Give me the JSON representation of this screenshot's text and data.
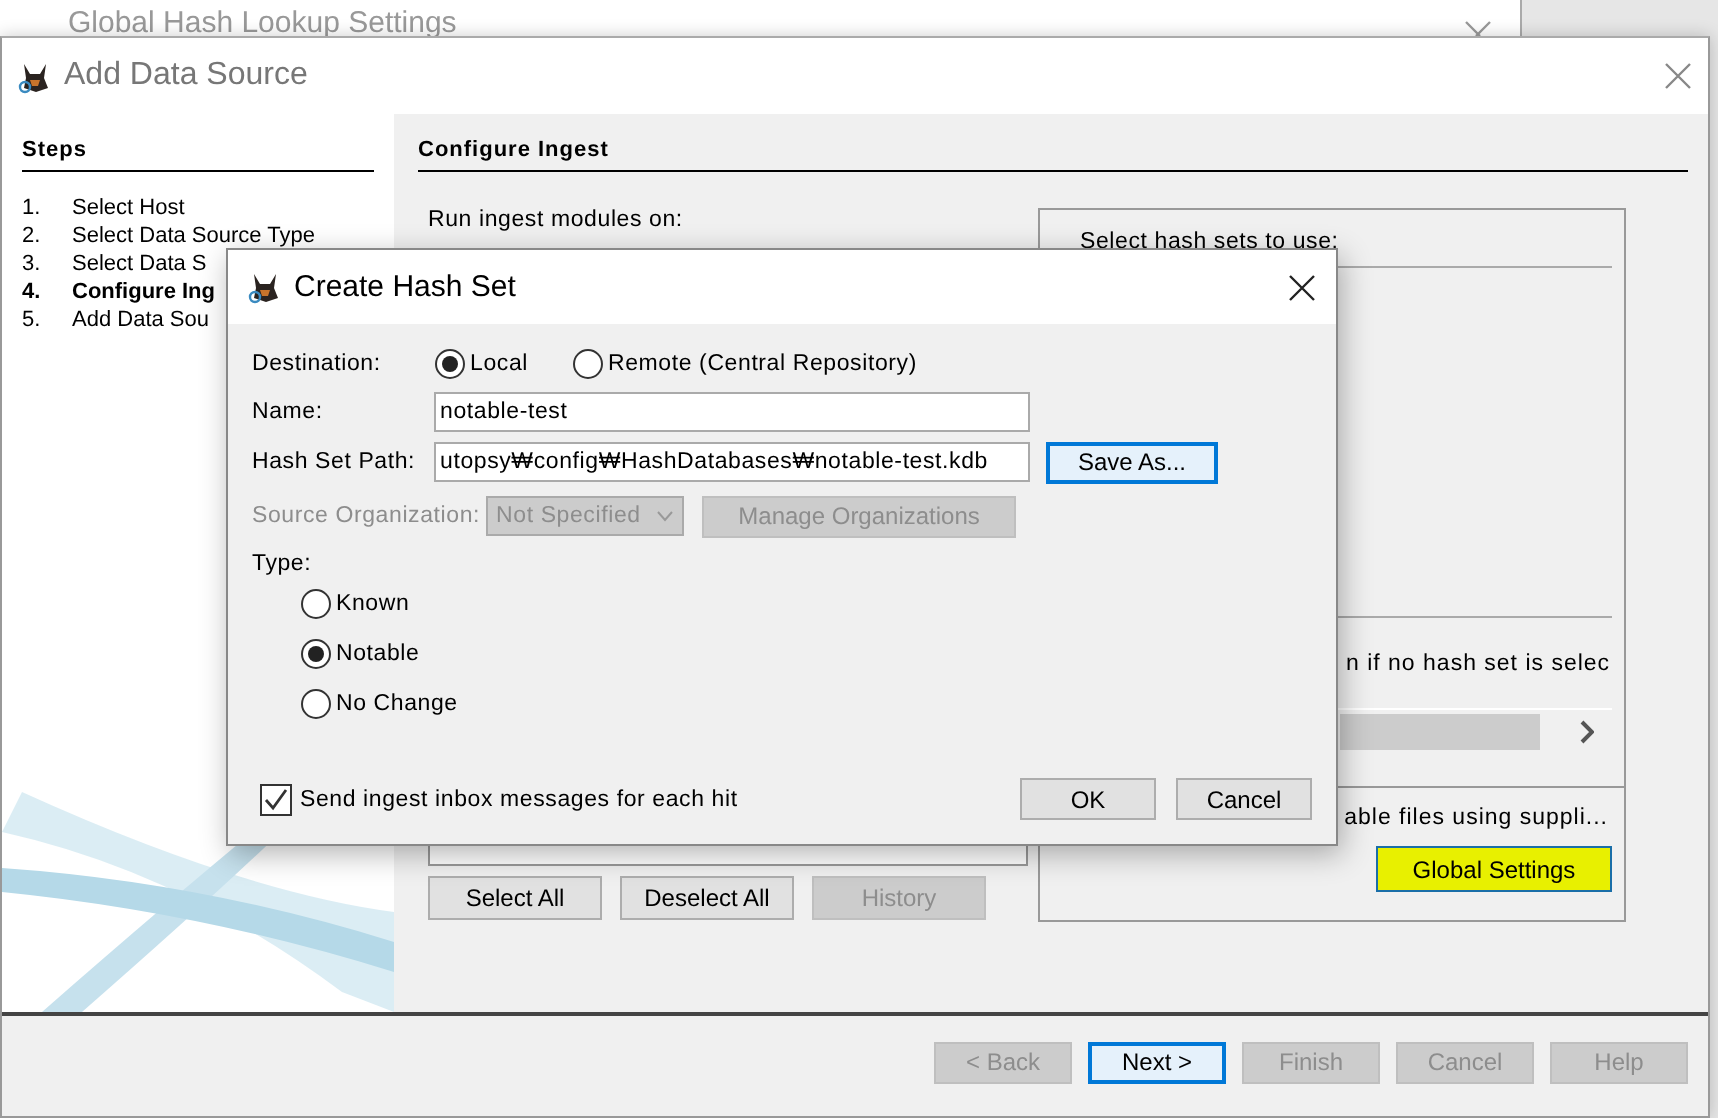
{
  "background_window": {
    "title": "Global Hash Lookup Settings"
  },
  "window": {
    "title": "Add Data Source"
  },
  "steps": {
    "heading": "Steps",
    "items": [
      {
        "number": "1.",
        "label": "Select Host",
        "selected": false
      },
      {
        "number": "2.",
        "label": "Select Data Source Type",
        "selected": false
      },
      {
        "number": "3.",
        "label": "Select Data S",
        "selected": false
      },
      {
        "number": "4.",
        "label": "Configure Ing",
        "selected": true
      },
      {
        "number": "5.",
        "label": "Add Data Sou",
        "selected": false
      }
    ]
  },
  "panel": {
    "heading": "Configure Ingest",
    "run_on_label": "Run ingest modules on:",
    "module_buttons": [
      {
        "label": "Select All",
        "disabled": false
      },
      {
        "label": "Deselect All",
        "disabled": false
      },
      {
        "label": "History",
        "disabled": true
      }
    ]
  },
  "hash_settings": {
    "heading": "Select hash sets to use:",
    "note": "n if no hash set is selec",
    "description": "able files using suppli...",
    "button": {
      "label": "Global Settings",
      "highlighted": true
    }
  },
  "navigation": [
    {
      "label": "< Back",
      "disabled": true,
      "focused": false
    },
    {
      "label": "Next >",
      "disabled": false,
      "focused": true
    },
    {
      "label": "Finish",
      "disabled": true,
      "focused": false
    },
    {
      "label": "Cancel",
      "disabled": true,
      "focused": false
    },
    {
      "label": "Help",
      "disabled": true,
      "focused": false
    }
  ],
  "dialog": {
    "title": "Create Hash Set",
    "destination_label": "Destination:",
    "destinations": [
      {
        "label": "Local",
        "selected": true
      },
      {
        "label": "Remote (Central Repository)",
        "selected": false
      }
    ],
    "name_label": "Name:",
    "name_value": "notable-test",
    "path_label": "Hash Set Path:",
    "path_value": "utopsy₩config₩HashDatabases₩notable-test.kdb",
    "save_button": {
      "label": "Save As...",
      "focused": true
    },
    "organization": {
      "label": "Source Organization:",
      "value": "Not Specified",
      "disabled": true
    },
    "manage_button": {
      "label": "Manage Organizations",
      "disabled": true
    },
    "type_label": "Type:",
    "types": [
      {
        "label": "Known",
        "selected": false
      },
      {
        "label": "Notable",
        "selected": true
      },
      {
        "label": "No Change",
        "selected": false
      }
    ],
    "inbox_checkbox": {
      "label": "Send ingest inbox messages for each hit",
      "checked": true
    },
    "buttons": [
      "OK",
      "Cancel"
    ]
  }
}
